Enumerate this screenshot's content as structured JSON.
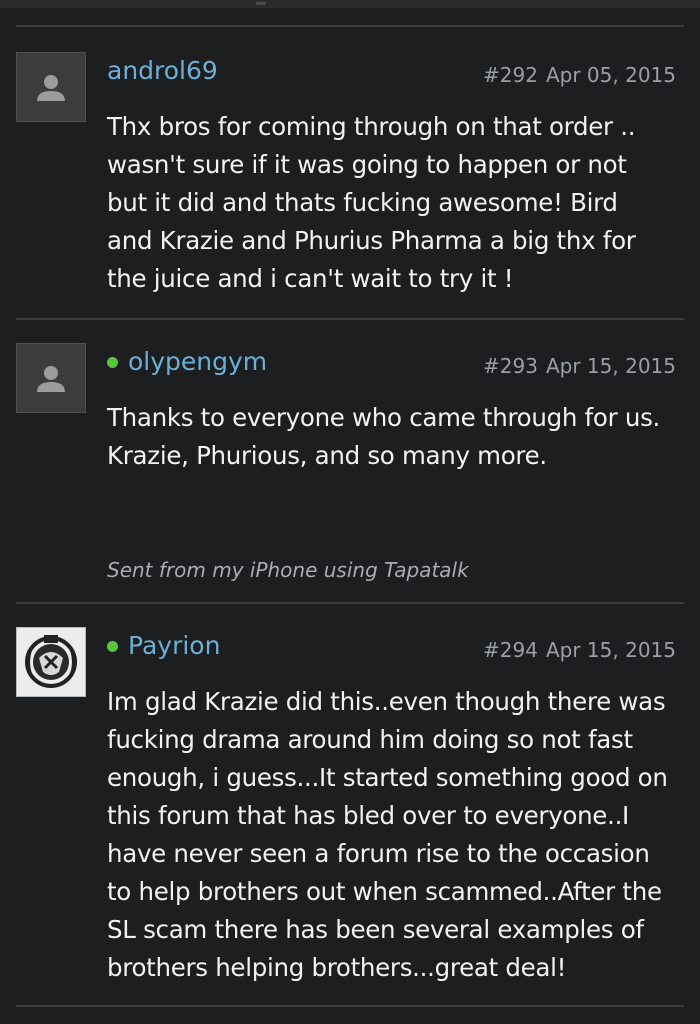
{
  "posts": [
    {
      "username": "androl69",
      "online": false,
      "post_number": "#292",
      "date": "Apr 05, 2015",
      "lines": [
        "Thx bros for coming through on that order ..",
        "wasn't sure if it was going to happen or not",
        "but it did and thats fucking awesome! Bird",
        "and Krazie and Phurius Pharma a big thx for",
        "the juice and i can't wait to try it !"
      ],
      "signature": ""
    },
    {
      "username": "olypengym",
      "online": true,
      "post_number": "#293",
      "date": "Apr 15, 2015",
      "lines": [
        "Thanks to everyone who came through for us.",
        "Krazie, Phurious, and so many more."
      ],
      "signature": "Sent from my iPhone using Tapatalk"
    },
    {
      "username": "Payrion",
      "online": true,
      "post_number": "#294",
      "date": "Apr 15, 2015",
      "lines": [
        "Im glad Krazie did this..even though there was",
        "fucking drama around him doing so not fast",
        "enough, i guess...It started something good on",
        "this forum that has bled over to everyone..I",
        "have never seen a forum rise to the occasion",
        "to help brothers out when scammed..After the",
        "SL scam there has been several examples of",
        "brothers helping brothers...great deal!"
      ],
      "signature": ""
    }
  ],
  "colors": {
    "background": "#1c1e1f",
    "username": "#6cb0d8",
    "online": "#5ac43f",
    "meta": "#9aa0a4",
    "text": "#f2f2f2"
  },
  "icons": {
    "default_avatar": "user-silhouette-icon",
    "payrion_avatar": "emblem-avatar"
  }
}
